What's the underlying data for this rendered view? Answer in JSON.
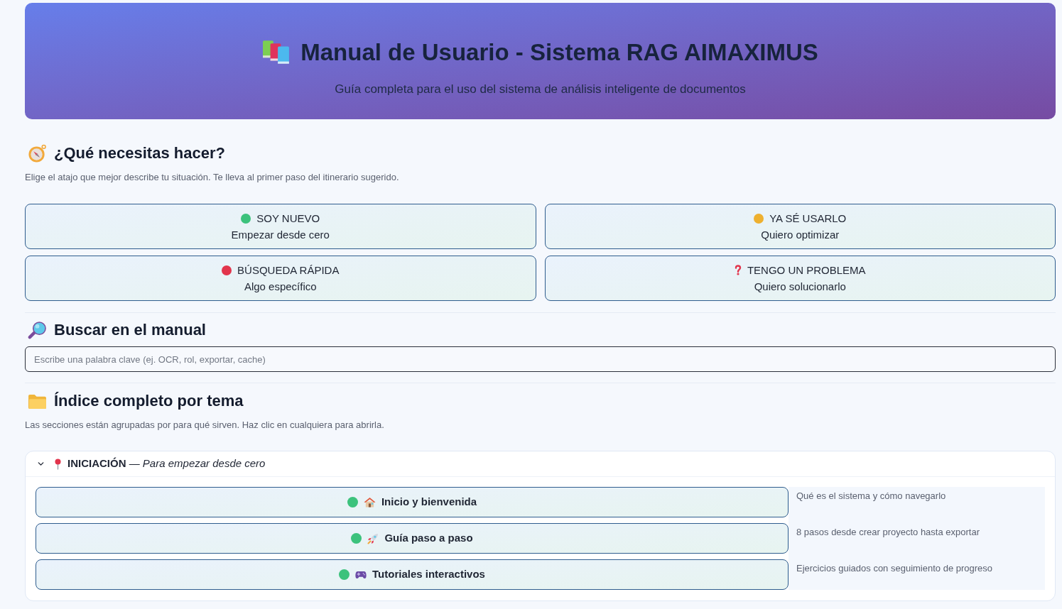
{
  "header": {
    "title": "Manual de Usuario - Sistema RAG AIMAXIMUS",
    "subtitle": "Guía completa para el uso del sistema de análisis inteligente de documentos"
  },
  "quick_start": {
    "heading": "¿Qué necesitas hacer?",
    "description": "Elige el atajo que mejor describe tu situación. Te lleva al primer paso del itinerario sugerido.",
    "options": [
      {
        "kind": "dot",
        "color": "#3cc27c",
        "label": "SOY NUEVO",
        "sublabel": "Empezar desde cero"
      },
      {
        "kind": "dot",
        "color": "#eeb02f",
        "label": "YA SÉ USARLO",
        "sublabel": "Quiero optimizar"
      },
      {
        "kind": "dot",
        "color": "#e2344c",
        "label": "BÚSQUEDA RÁPIDA",
        "sublabel": "Algo específico"
      },
      {
        "kind": "question",
        "label": "TENGO UN PROBLEMA",
        "sublabel": "Quiero solucionarlo"
      }
    ]
  },
  "search": {
    "heading": "Buscar en el manual",
    "placeholder": "Escribe una palabra clave (ej. OCR, rol, exportar, cache)"
  },
  "index": {
    "heading": "Índice completo por tema",
    "description": "Las secciones están agrupadas por para qué sirven. Haz clic en cualquiera para abrirla.",
    "groups": [
      {
        "title": "**INICIACIÓN** — *Para empezar desde cero*",
        "expanded": true,
        "sections": [
          {
            "color": "#3cc27c",
            "label": "Inicio y bienvenida",
            "description": "Qué es el sistema y cómo navegarlo"
          },
          {
            "color": "#3cc27c",
            "label": "Guía paso a paso",
            "description": "8 pasos desde crear proyecto hasta exportar"
          },
          {
            "color": "#3cc27c",
            "label": "Tutoriales interactivos",
            "description": "Ejercicios guiados con seguimiento de progreso"
          }
        ]
      }
    ]
  }
}
